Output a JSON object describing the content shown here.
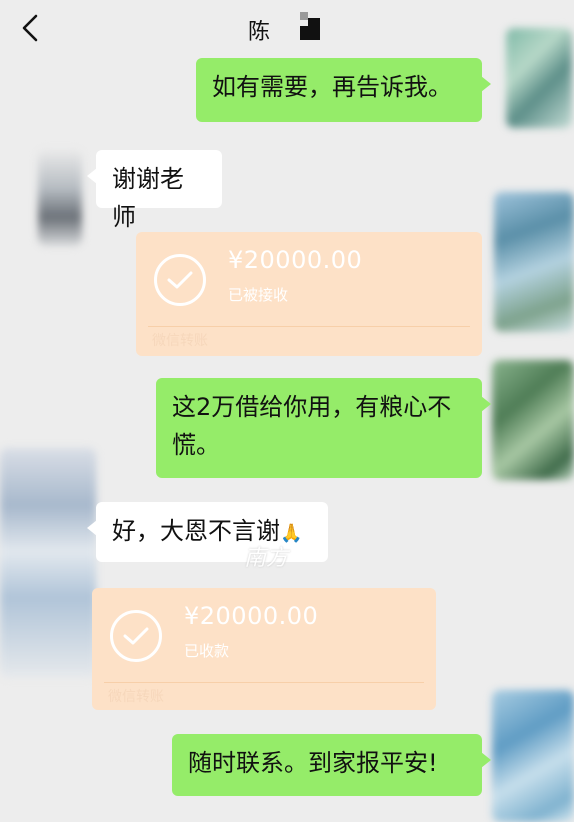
{
  "header": {
    "back_icon": "chevron-left-icon",
    "contact_name": "陈"
  },
  "messages": [
    {
      "sender": "me",
      "text": "如有需要，再告诉我。"
    },
    {
      "sender": "other",
      "text": "谢谢老师"
    },
    {
      "sender": "me",
      "type": "transfer",
      "amount": "¥20000.00",
      "status": "已被接收",
      "label": "微信转账"
    },
    {
      "sender": "me",
      "text_line1": "这2万借给你用，有粮心不",
      "text_line2": "慌。"
    },
    {
      "sender": "other",
      "text": "好，大恩不言谢",
      "emoji": "🙏"
    },
    {
      "sender": "other",
      "type": "transfer",
      "amount": "¥20000.00",
      "status": "已收款",
      "label": "微信转账"
    },
    {
      "sender": "me",
      "text": "随时联系。到家报平安!"
    }
  ],
  "watermark": "南方",
  "colors": {
    "background": "#ededed",
    "my_bubble": "#95ec69",
    "other_bubble": "#ffffff",
    "transfer_card": "#fde1c7"
  }
}
